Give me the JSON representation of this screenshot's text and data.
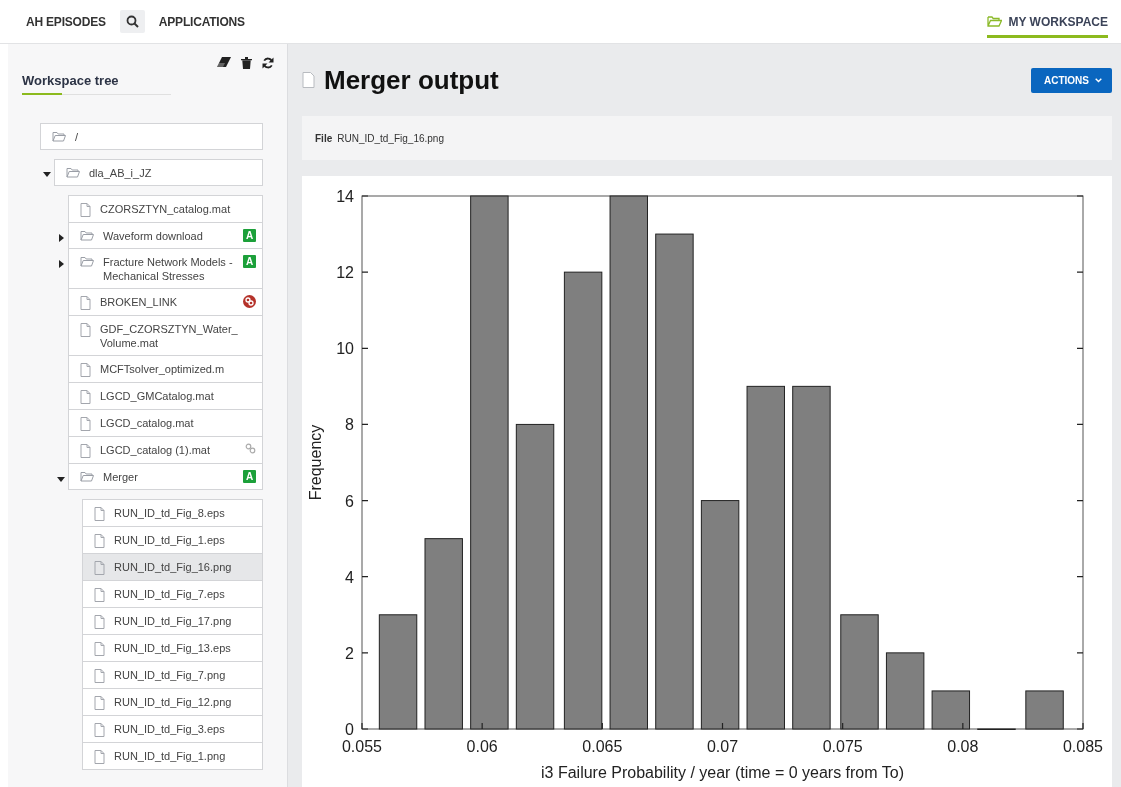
{
  "nav": {
    "items": [
      {
        "kind": "link",
        "label": "AH EPISODES"
      },
      {
        "kind": "search"
      },
      {
        "kind": "link",
        "label": "APPLICATIONS"
      }
    ],
    "workspace": {
      "label": "MY WORKSPACE",
      "selected": true
    }
  },
  "sidebar": {
    "title": "Workspace tree",
    "tree": {
      "kind": "folder",
      "label": "/",
      "selected": false,
      "children": [
        {
          "kind": "folder",
          "label": "dla_AB_i_JZ",
          "expanded": true,
          "selected": false,
          "children": [
            {
              "kind": "file",
              "label": "CZORSZTYN_catalog.mat",
              "selected": false
            },
            {
              "kind": "folder",
              "label": "Waveform download",
              "expanded": false,
              "selected": false,
              "badge": {
                "kind": "app",
                "label": "A"
              }
            },
            {
              "kind": "folder",
              "label": "Fracture Network Models - Mechanical Stresses",
              "expanded": false,
              "selected": false,
              "badge": {
                "kind": "app",
                "label": "A"
              }
            },
            {
              "kind": "file",
              "label": "BROKEN_LINK",
              "selected": false,
              "badge": {
                "kind": "broken"
              }
            },
            {
              "kind": "file",
              "label": "GDF_CZORSZTYN_Water_Volume.mat",
              "selected": false
            },
            {
              "kind": "file",
              "label": "MCFTsolver_optimized.m",
              "selected": false
            },
            {
              "kind": "file",
              "label": "LGCD_GMCatalog.mat",
              "selected": false
            },
            {
              "kind": "file",
              "label": "LGCD_catalog.mat",
              "selected": false
            },
            {
              "kind": "file",
              "label": "LGCD_catalog (1).mat",
              "selected": false,
              "badge": {
                "kind": "link"
              }
            },
            {
              "kind": "folder",
              "label": "Merger",
              "expanded": true,
              "selected": false,
              "badge": {
                "kind": "app",
                "label": "A"
              },
              "children": [
                {
                  "kind": "file",
                  "label": "RUN_ID_td_Fig_8.eps",
                  "selected": false
                },
                {
                  "kind": "file",
                  "label": "RUN_ID_td_Fig_1.eps",
                  "selected": false
                },
                {
                  "kind": "file",
                  "label": "RUN_ID_td_Fig_16.png",
                  "selected": true
                },
                {
                  "kind": "file",
                  "label": "RUN_ID_td_Fig_7.eps",
                  "selected": false
                },
                {
                  "kind": "file",
                  "label": "RUN_ID_td_Fig_17.png",
                  "selected": false
                },
                {
                  "kind": "file",
                  "label": "RUN_ID_td_Fig_13.eps",
                  "selected": false
                },
                {
                  "kind": "file",
                  "label": "RUN_ID_td_Fig_7.png",
                  "selected": false
                },
                {
                  "kind": "file",
                  "label": "RUN_ID_td_Fig_12.png",
                  "selected": false
                },
                {
                  "kind": "file",
                  "label": "RUN_ID_td_Fig_3.eps",
                  "selected": false
                },
                {
                  "kind": "file",
                  "label": "RUN_ID_td_Fig_1.png",
                  "selected": false
                }
              ]
            }
          ]
        }
      ]
    }
  },
  "main": {
    "title": "Merger output",
    "actions": "ACTIONS",
    "file": {
      "label": "File",
      "value": "RUN_ID_td_Fig_16.png"
    },
    "chart_data": {
      "type": "bar",
      "xlabel": "i3 Failure Probability / year (time = 0 years from To)",
      "ylabel": "Frequency",
      "x": [
        0.0565,
        0.0584,
        0.0603,
        0.0622,
        0.0642,
        0.0661,
        0.068,
        0.0699,
        0.0718,
        0.0737,
        0.0757,
        0.0776,
        0.0795,
        0.0814,
        0.0834
      ],
      "values": [
        3,
        5,
        14,
        8,
        12,
        14,
        13,
        6,
        9,
        9,
        3,
        2,
        1,
        0,
        1
      ],
      "xlim": [
        0.055,
        0.085
      ],
      "ylim": [
        0,
        14
      ],
      "xticks": [
        0.055,
        0.06,
        0.065,
        0.07,
        0.075,
        0.08,
        0.085
      ],
      "yticks": [
        0,
        2,
        4,
        6,
        8,
        10,
        12,
        14
      ]
    }
  }
}
